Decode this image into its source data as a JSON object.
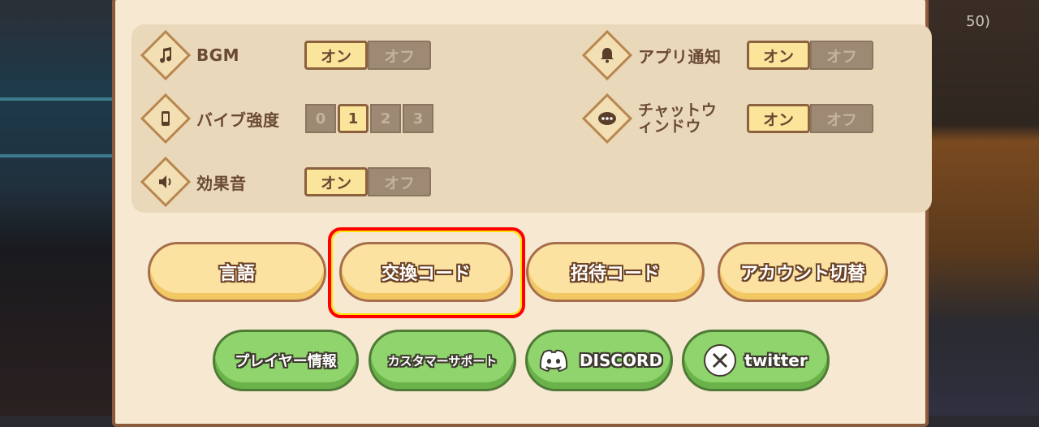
{
  "background": {
    "right_stat": "50)",
    "right_stat_top": "30"
  },
  "settings": {
    "bgm": {
      "label": "BGM",
      "on": "オン",
      "off": "オフ",
      "icon": "music-note-icon"
    },
    "vibe": {
      "label": "バイブ強度",
      "levels": [
        "0",
        "1",
        "2",
        "3"
      ],
      "selected": "1",
      "icon": "phone-vibrate-icon"
    },
    "sfx": {
      "label": "効果音",
      "on": "オン",
      "off": "オフ",
      "icon": "speaker-icon"
    },
    "notify": {
      "label": "アプリ通知",
      "on": "オン",
      "off": "オフ",
      "icon": "bell-icon"
    },
    "chat": {
      "label_line1": "チャットウ",
      "label_line2": "ィンドウ",
      "on": "オン",
      "off": "オフ",
      "icon": "chat-bubble-icon"
    }
  },
  "buttons": {
    "language": "言語",
    "exchange_code": "交換コード",
    "invite_code": "招待コード",
    "account_switch": "アカウント切替"
  },
  "links": {
    "player_info": "プレイヤー情報",
    "customer_support": "カスタマーサポート",
    "discord": "DISCORD",
    "twitter": "twitter"
  },
  "colors": {
    "highlight": "#ff0000",
    "accent_yellow": "#fbe2a0",
    "accent_green": "#8fd46c"
  }
}
